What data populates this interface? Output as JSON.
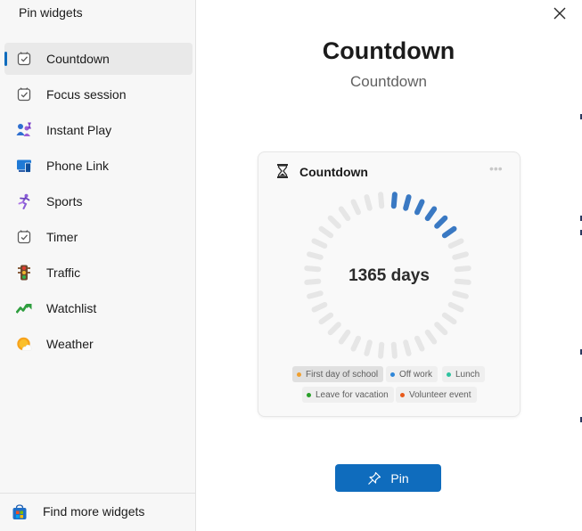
{
  "sidebar": {
    "title": "Pin widgets",
    "items": [
      {
        "label": "Countdown",
        "icon": "countdown-icon",
        "selected": true
      },
      {
        "label": "Focus session",
        "icon": "focus-session-icon",
        "selected": false
      },
      {
        "label": "Instant Play",
        "icon": "instant-play-icon",
        "selected": false
      },
      {
        "label": "Phone Link",
        "icon": "phone-link-icon",
        "selected": false
      },
      {
        "label": "Sports",
        "icon": "sports-icon",
        "selected": false
      },
      {
        "label": "Timer",
        "icon": "timer-icon",
        "selected": false
      },
      {
        "label": "Traffic",
        "icon": "traffic-light-icon",
        "selected": false
      },
      {
        "label": "Watchlist",
        "icon": "watchlist-icon",
        "selected": false
      },
      {
        "label": "Weather",
        "icon": "weather-icon",
        "selected": false
      }
    ],
    "footer_label": "Find more widgets"
  },
  "main": {
    "title": "Countdown",
    "subtitle": "Countdown",
    "close_icon": "close-icon"
  },
  "preview": {
    "header_title": "Countdown",
    "header_icon": "hourglass-icon",
    "days_text": "1365 days",
    "progress_segments": 6,
    "total_segments": 36,
    "progress_color": "#3a79c3",
    "track_color": "#e6e6e6",
    "chips": [
      {
        "label": "First day of school",
        "color": "#f0a030",
        "active": true
      },
      {
        "label": "Off work",
        "color": "#2f86d8",
        "active": false
      },
      {
        "label": "Lunch",
        "color": "#2fc2a0",
        "active": false
      },
      {
        "label": "Leave for vacation",
        "color": "#2aa02a",
        "active": false
      },
      {
        "label": "Volunteer event",
        "color": "#e85a1a",
        "active": false
      }
    ]
  },
  "pin_button": {
    "label": "Pin",
    "icon": "pin-icon",
    "color": "#0f6cbd"
  }
}
